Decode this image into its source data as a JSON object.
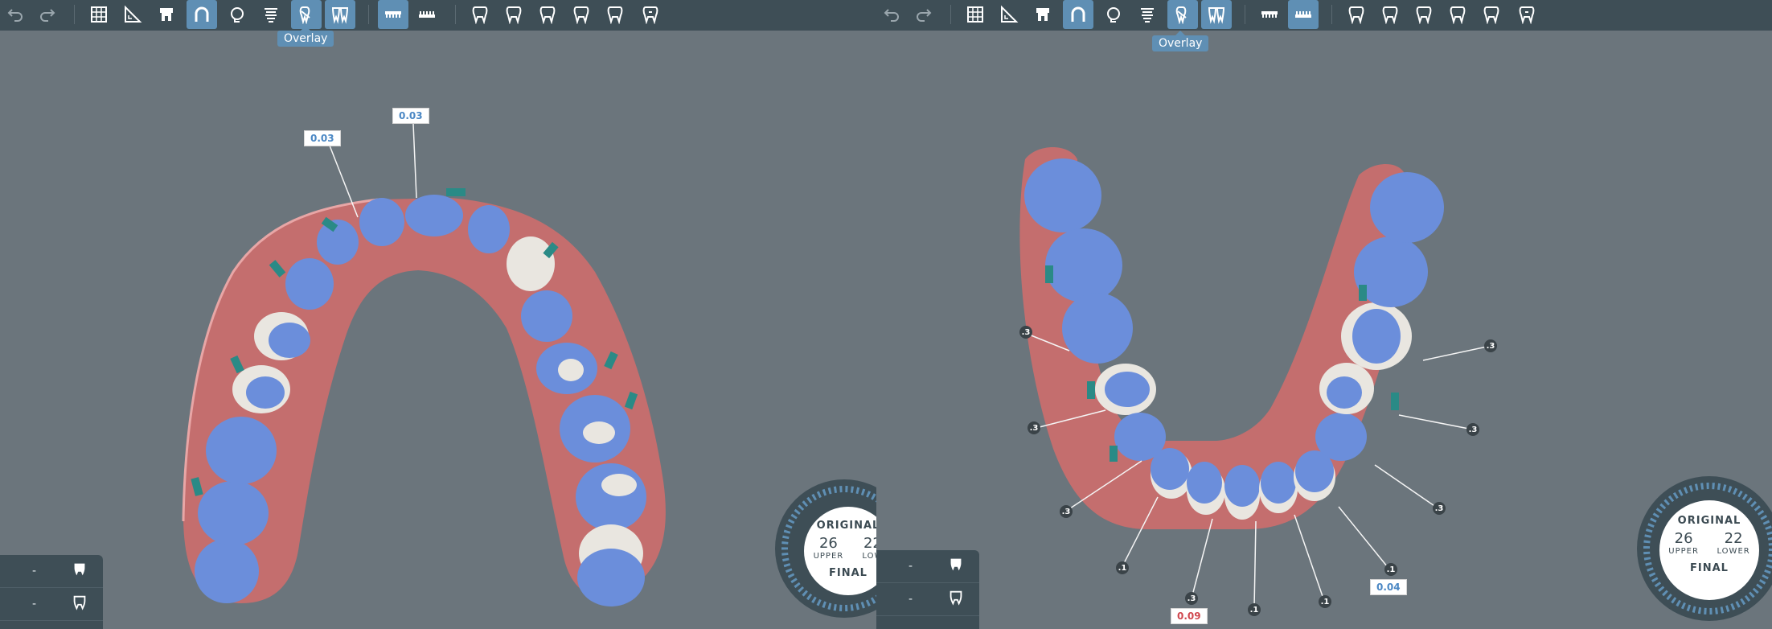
{
  "left_view": {
    "tooltip": "Overlay",
    "toolbar": {
      "undo_icon": "undo-icon",
      "redo_icon": "redo-icon",
      "grid_icon": "grid-icon",
      "ruler_icon": "ruler-icon",
      "attachments_icon": "attachments-icon",
      "arch_icon": "arch-icon",
      "head_icon": "head-icon",
      "ipr_icon": "ipr-icon",
      "overlay_icon": "overlay-icon",
      "superimpose_icon": "superimpose-icon",
      "upper_jaw_icon": "upper-jaw-icon",
      "lower_jaw_icon": "lower-jaw-icon"
    },
    "ipr_tags": [
      "0.03",
      "0.03"
    ],
    "side_list": [
      {
        "label": "-",
        "icon": "upper-tooth-icon"
      },
      {
        "label": "-",
        "icon": "lower-tooth-icon"
      }
    ],
    "dial": {
      "original": "ORIGINAL",
      "upper_count": "26",
      "upper_label": "UPPER",
      "lower_count": "22",
      "lower_label": "LOW",
      "final": "FINAL"
    }
  },
  "right_view": {
    "tooltip": "Overlay",
    "ipr_tags": [
      ".3",
      ".3",
      ".3",
      ".1",
      ".3",
      ".1",
      ".1",
      ".1",
      ".3",
      ".3",
      ".3"
    ],
    "ipr_values": {
      "red": "0.09",
      "blue": "0.04"
    },
    "side_list": [
      {
        "label": "-",
        "icon": "upper-tooth-icon"
      },
      {
        "label": "-",
        "icon": "lower-tooth-icon"
      }
    ],
    "dial": {
      "original": "ORIGINAL",
      "upper_count": "26",
      "upper_label": "UPPER",
      "lower_count": "22",
      "lower_label": "LOWER",
      "final": "FINAL"
    }
  },
  "colors": {
    "toolbar": "#3e4e56",
    "background": "#6b757c",
    "active": "#5f8fb4",
    "tooth_blue": "#6b8edb",
    "tooth_white": "#e9e6e0",
    "gum": "#c46e6e",
    "attachment": "#2a8a86"
  }
}
